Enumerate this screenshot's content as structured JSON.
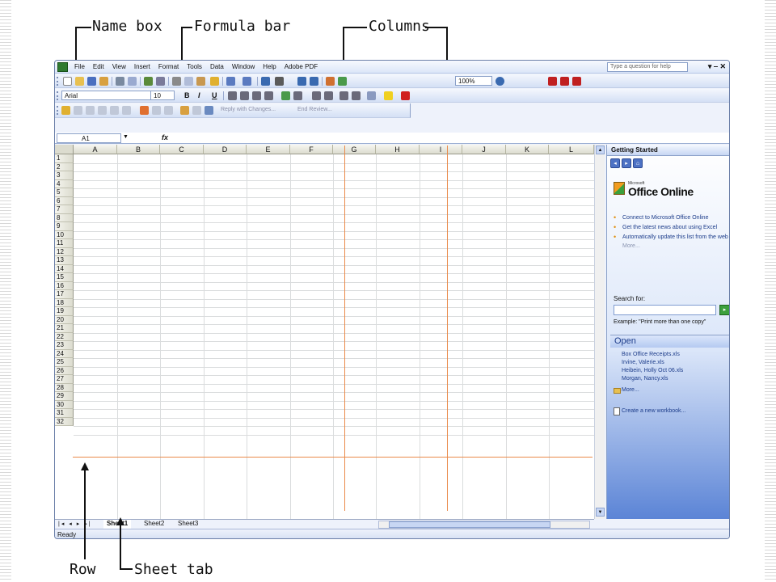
{
  "callouts": {
    "name_box": "Name box",
    "formula_bar": "Formula bar",
    "columns": "Columns",
    "row": "Row",
    "sheet_tab": "Sheet tab"
  },
  "menu": [
    "File",
    "Edit",
    "View",
    "Insert",
    "Format",
    "Tools",
    "Data",
    "Window",
    "Help",
    "Adobe PDF"
  ],
  "help_box": "Type a question for help",
  "window_controls": "▾ ‒ ✕",
  "formatting": {
    "font": "Arial",
    "size": "10",
    "bold": "B",
    "italic": "I",
    "underline": "U",
    "zoom": "100%"
  },
  "review_bar": {
    "reply": "Reply with Changes...",
    "end_review": "End Review..."
  },
  "formula": {
    "name_box_value": "A1",
    "fx": "fx"
  },
  "columns": [
    "A",
    "B",
    "C",
    "D",
    "E",
    "F",
    "G",
    "H",
    "I",
    "J",
    "K",
    "L"
  ],
  "rows": [
    "1",
    "2",
    "3",
    "4",
    "5",
    "6",
    "7",
    "8",
    "9",
    "10",
    "11",
    "12",
    "13",
    "14",
    "15",
    "16",
    "17",
    "18",
    "19",
    "20",
    "21",
    "22",
    "23",
    "24",
    "25",
    "26",
    "27",
    "28",
    "29",
    "30",
    "31",
    "32"
  ],
  "sheet_tabs": [
    "Sheet1",
    "Sheet2",
    "Sheet3"
  ],
  "active_sheet": "Sheet1",
  "status": "Ready",
  "task_pane": {
    "title": "Getting Started",
    "logo_small": "Microsoft",
    "logo": "Office Online",
    "bullets": [
      "Connect to Microsoft Office Online",
      "Get the latest news about using Excel",
      "Automatically update this list from the web"
    ],
    "more": "More...",
    "search_label": "Search for:",
    "example": "Example: \"Print more than one copy\"",
    "open_title": "Open",
    "files": [
      "Box Office Receipts.xls",
      "Irvine, Valerie.xls",
      "Heibein, Holly Oct 06.xls",
      "Morgan, Nancy.xls"
    ],
    "files_more": "More...",
    "new_workbook": "Create a new workbook..."
  },
  "colors": {
    "accent_orange": "#ea8a4a",
    "window_blue": "#dbe6f8"
  }
}
